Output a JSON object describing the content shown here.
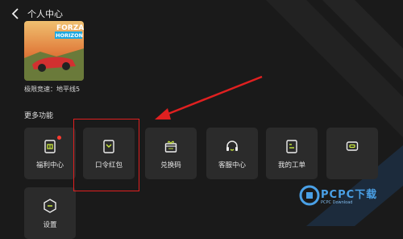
{
  "header": {
    "title": "个人中心"
  },
  "game": {
    "name": "极限竞速：地平线5",
    "cover_logo_line1": "FORZA",
    "cover_logo_line2": "HORIZON"
  },
  "section": {
    "title": "更多功能"
  },
  "tiles": [
    {
      "label": "福利中心",
      "icon": "gift-calendar-icon",
      "badge": true
    },
    {
      "label": "口令红包",
      "icon": "red-packet-icon",
      "highlighted": true
    },
    {
      "label": "兑换码",
      "icon": "gift-box-icon"
    },
    {
      "label": "客服中心",
      "icon": "headset-icon"
    },
    {
      "label": "我的工单",
      "icon": "clipboard-icon"
    },
    {
      "label": "",
      "icon": "ticket-icon"
    },
    {
      "label": "设置",
      "icon": "hexagon-settings-icon"
    }
  ],
  "watermark": {
    "text": "PCPC下载",
    "sub": "PCPC Download"
  },
  "colors": {
    "accent": "#c8e63c",
    "annotation": "#e02020",
    "tile_bg": "#2b2b2b"
  }
}
